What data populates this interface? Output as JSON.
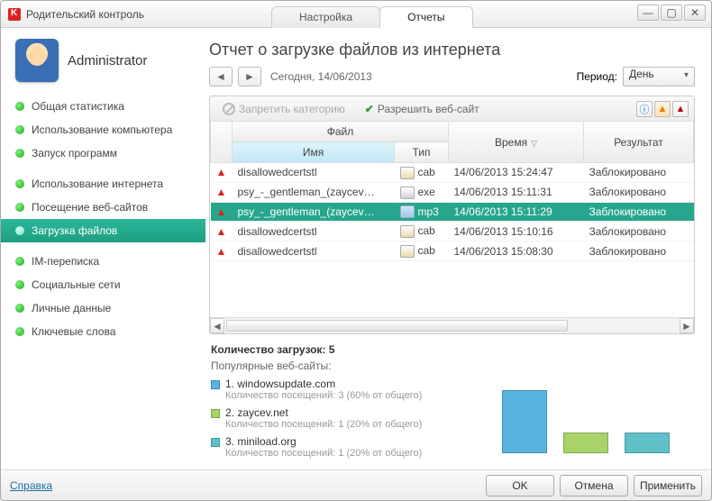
{
  "window": {
    "title": "Родительский контроль"
  },
  "tabs": [
    {
      "label": "Настройка",
      "active": false
    },
    {
      "label": "Отчеты",
      "active": true
    }
  ],
  "user": {
    "name": "Administrator"
  },
  "sidebar": {
    "items": [
      {
        "label": "Общая статистика"
      },
      {
        "label": "Использование компьютера"
      },
      {
        "label": "Запуск программ"
      },
      {
        "label": "Использование интернета"
      },
      {
        "label": "Посещение веб-сайтов"
      },
      {
        "label": "Загрузка файлов"
      },
      {
        "label": "IM-переписка"
      },
      {
        "label": "Социальные сети"
      },
      {
        "label": "Личные данные"
      },
      {
        "label": "Ключевые слова"
      }
    ],
    "active_index": 5
  },
  "page": {
    "title": "Отчет о загрузке файлов из интернета",
    "date_text": "Сегодня, 14/06/2013",
    "period_label": "Период:",
    "period_value": "День"
  },
  "toolbar": {
    "forbid_label": "Запретить категорию",
    "allow_label": "Разрешить веб-сайт"
  },
  "grid": {
    "group_header": "Файл",
    "columns": {
      "name": "Имя",
      "type": "Тип",
      "time": "Время",
      "result": "Результат"
    },
    "sort_column": "time",
    "rows": [
      {
        "name": "disallowedcertstl",
        "type": "cab",
        "time": "14/06/2013 15:24:47",
        "result": "Заблокировано",
        "selected": false
      },
      {
        "name": "psy_-_gentleman_(zaycev…",
        "type": "exe",
        "time": "14/06/2013 15:11:31",
        "result": "Заблокировано",
        "selected": false
      },
      {
        "name": "psy_-_gentleman_(zaycev…",
        "type": "mp3",
        "time": "14/06/2013 15:11:29",
        "result": "Заблокировано",
        "selected": true
      },
      {
        "name": "disallowedcertstl",
        "type": "cab",
        "time": "14/06/2013 15:10:16",
        "result": "Заблокировано",
        "selected": false
      },
      {
        "name": "disallowedcertstl",
        "type": "cab",
        "time": "14/06/2013 15:08:30",
        "result": "Заблокировано",
        "selected": false
      }
    ]
  },
  "summary": {
    "count_label": "Количество загрузок: 5",
    "sites_label": "Популярные веб-сайты:",
    "sites": [
      {
        "rank": "1.",
        "name": "windowsupdate.com",
        "sub": "Количество посещений: 3 (60% от общего)",
        "color": "sq-blue"
      },
      {
        "rank": "2.",
        "name": "zaycev.net",
        "sub": "Количество посещений: 1 (20% от общего)",
        "color": "sq-green"
      },
      {
        "rank": "3.",
        "name": "miniload.org",
        "sub": "Количество посещений: 1 (20% от общего)",
        "color": "sq-teal"
      }
    ]
  },
  "chart_data": {
    "type": "bar",
    "categories": [
      "windowsupdate.com",
      "zaycev.net",
      "miniload.org"
    ],
    "values": [
      3,
      1,
      1
    ],
    "colors": [
      "#58b3e0",
      "#a7d36a",
      "#5fc0c7"
    ],
    "ylim": [
      0,
      3
    ]
  },
  "footer": {
    "help": "Справка",
    "ok": "OK",
    "cancel": "Отмена",
    "apply": "Применить"
  }
}
